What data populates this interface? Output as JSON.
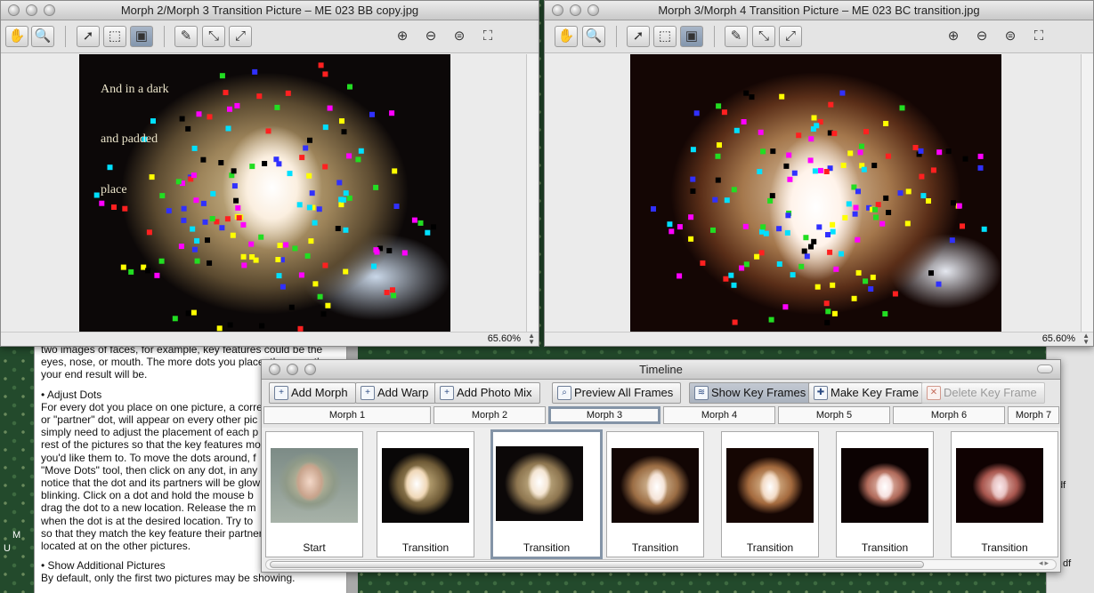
{
  "window_left": {
    "title": "Morph 2/Morph 3 Transition Picture – ME 023 BB copy.jpg",
    "zoom": "65.60%",
    "overlay_lines": [
      "And in a dark",
      "and padded",
      "place"
    ]
  },
  "window_right": {
    "title": "Morph 3/Morph 4 Transition Picture – ME 023 BC transition.jpg",
    "zoom": "65.60%"
  },
  "toolbar_icons": [
    "hand-icon",
    "magnify-icon",
    "select-arrow-icon",
    "select-marquee-icon",
    "move-dots-icon",
    "add-dot-icon",
    "remove-dot-icon",
    "link-dot-icon",
    "zoom-in-icon",
    "zoom-out-icon",
    "zoom-fit-icon",
    "fullscreen-icon"
  ],
  "document": {
    "lines": [
      "two images of faces, for example, key features could be the",
      "eyes, nose, or mouth.  The more dots you place, the smoother",
      "your end result will be."
    ],
    "adjust_heading": "• Adjust Dots",
    "adjust_lines": [
      "For every dot you place on one picture, a corre",
      "or \"partner\" dot, will appear on every other pic",
      "simply need to adjust the placement of each p",
      "rest of the pictures so that the key features mo",
      "you'd like them to.  To move the dots around, f",
      "\"Move Dots\" tool, then click on any dot, in any",
      "notice that the dot and its partners will be glow",
      "blinking.  Click on a dot and hold the mouse b",
      "drag the dot to a new location.  Release the m",
      "when the dot is at the desired location.  Try to",
      "so that they match the key feature their partner",
      "located at on the other pictures."
    ],
    "show_heading": "• Show Additional Pictures",
    "show_lines": [
      "By default, only the first two pictures may be showing."
    ]
  },
  "right_strip": {
    "a": "df",
    "b": "df"
  },
  "left_strip": {
    "a": "M",
    "b": "U"
  },
  "timeline": {
    "title": "Timeline",
    "buttons": {
      "add_morph": "Add Morph",
      "add_warp": "Add Warp",
      "add_photo_mix": "Add Photo Mix",
      "preview_all": "Preview All Frames",
      "show_key_frames": "Show Key Frames",
      "make_key_frame": "Make Key Frame",
      "delete_key_frame": "Delete Key Frame"
    },
    "tabs": [
      "Morph 1",
      "Morph 2",
      "Morph 3",
      "Morph 4",
      "Morph 5",
      "Morph 6",
      "Morph 7"
    ],
    "selected_tab": "Morph 3",
    "frames": [
      {
        "label": "Start"
      },
      {
        "label": "Transition"
      },
      {
        "label": "Transition"
      },
      {
        "label": "Transition"
      },
      {
        "label": "Transition"
      },
      {
        "label": "Transition"
      },
      {
        "label": "Transition"
      }
    ]
  },
  "dot_colors": [
    "#ff00ff",
    "#00e0ff",
    "#ffff00",
    "#22dd22",
    "#000000",
    "#ff2020",
    "#3030ff"
  ]
}
